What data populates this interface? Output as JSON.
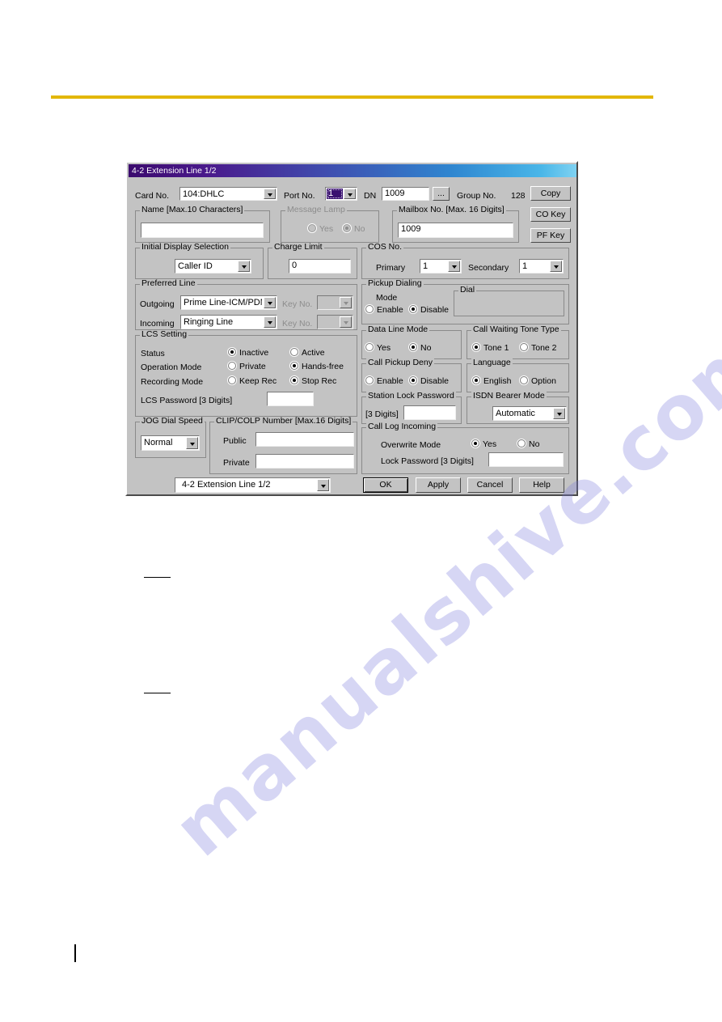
{
  "watermark": {
    "text": "manualshive.com"
  },
  "dialog": {
    "title": "4-2 Extension Line 1/2",
    "header": {
      "card_no_label": "Card No.",
      "card_no_value": "104:DHLC",
      "port_no_label": "Port No.",
      "port_no_value": "1",
      "dn_label": "DN",
      "dn_value": "1009",
      "dn_browse_label": "...",
      "group_no_label": "Group No.",
      "group_no_value": "128"
    },
    "side_buttons": [
      {
        "label": "Copy",
        "name": "copy-button"
      },
      {
        "label": "CO Key",
        "name": "co-key-button"
      },
      {
        "label": "PF Key",
        "name": "pf-key-button"
      }
    ],
    "name_group": {
      "legend": "Name [Max.10 Characters]",
      "value": ""
    },
    "message_lamp": {
      "legend": "Message Lamp",
      "yes_label": "Yes",
      "no_label": "No",
      "selected": "No",
      "disabled": true
    },
    "mailbox": {
      "legend": "Mailbox No. [Max. 16 Digits]",
      "value": "1009"
    },
    "initial_display": {
      "legend": "Initial Display Selection",
      "value": "Caller ID"
    },
    "charge_limit": {
      "legend": "Charge Limit",
      "value": "0"
    },
    "cos_no": {
      "legend": "COS No.",
      "primary_label": "Primary",
      "primary_value": "1",
      "secondary_label": "Secondary",
      "secondary_value": "1"
    },
    "preferred_line": {
      "legend": "Preferred Line",
      "outgoing_label": "Outgoing",
      "outgoing_value": "Prime Line-ICM/PDN",
      "outgoing_key_label": "Key No.",
      "outgoing_key_value": "",
      "incoming_label": "Incoming",
      "incoming_value": "Ringing Line",
      "incoming_key_label": "Key No.",
      "incoming_key_value": ""
    },
    "pickup_dialing": {
      "legend": "Pickup Dialing",
      "mode_label": "Mode",
      "enable_label": "Enable",
      "disable_label": "Disable",
      "selected": "Disable",
      "dial_legend": "Dial",
      "dial_value": ""
    },
    "data_line_mode": {
      "legend": "Data Line Mode",
      "yes_label": "Yes",
      "no_label": "No",
      "selected": "No"
    },
    "call_waiting_tone": {
      "legend": "Call Waiting Tone Type",
      "tone1_label": "Tone 1",
      "tone2_label": "Tone 2",
      "selected": "Tone 1"
    },
    "call_pickup_deny": {
      "legend": "Call Pickup Deny",
      "enable_label": "Enable",
      "disable_label": "Disable",
      "selected": "Disable"
    },
    "language": {
      "legend": "Language",
      "english_label": "English",
      "option_label": "Option",
      "selected": "English"
    },
    "lcs_setting": {
      "legend": "LCS Setting",
      "status_label": "Status",
      "status_option_1": "Inactive",
      "status_option_2": "Active",
      "status_selected": "Inactive",
      "operation_label": "Operation Mode",
      "operation_option_1": "Private",
      "operation_option_2": "Hands-free",
      "operation_selected": "Hands-free",
      "recording_label": "Recording Mode",
      "recording_option_1": "Keep Rec",
      "recording_option_2": "Stop Rec",
      "recording_selected": "Stop Rec",
      "password_label": "LCS Password [3 Digits]",
      "password_value": ""
    },
    "station_lock": {
      "legend": "Station Lock Password",
      "digits_label": "[3 Digits]",
      "value": ""
    },
    "isdn_bearer": {
      "legend": "ISDN Bearer Mode",
      "value": "Automatic"
    },
    "call_log_incoming": {
      "legend": "Call Log Incoming",
      "overwrite_label": "Overwrite Mode",
      "yes_label": "Yes",
      "no_label": "No",
      "selected": "Yes",
      "lock_password_label": "Lock Password [3 Digits]",
      "lock_password_value": ""
    },
    "jog_dial_speed": {
      "legend": "JOG Dial Speed",
      "value": "Normal"
    },
    "clip_colp": {
      "legend": "CLIP/COLP Number [Max.16 Digits]",
      "public_label": "Public",
      "public_value": "",
      "private_label": "Private",
      "private_value": ""
    },
    "page_selector": {
      "value": "4-2 Extension Line 1/2"
    },
    "footer_buttons": [
      {
        "label": "OK",
        "name": "ok-button"
      },
      {
        "label": "Apply",
        "name": "apply-button"
      },
      {
        "label": "Cancel",
        "name": "cancel-button"
      },
      {
        "label": "Help",
        "name": "help-button"
      }
    ]
  },
  "colors": {
    "accent_rule": "#e3b707",
    "dialog_face": "#c3c3c3",
    "title_start": "#3b0a6e",
    "title_end": "#7fd2f2",
    "selection": "#3a1170"
  }
}
